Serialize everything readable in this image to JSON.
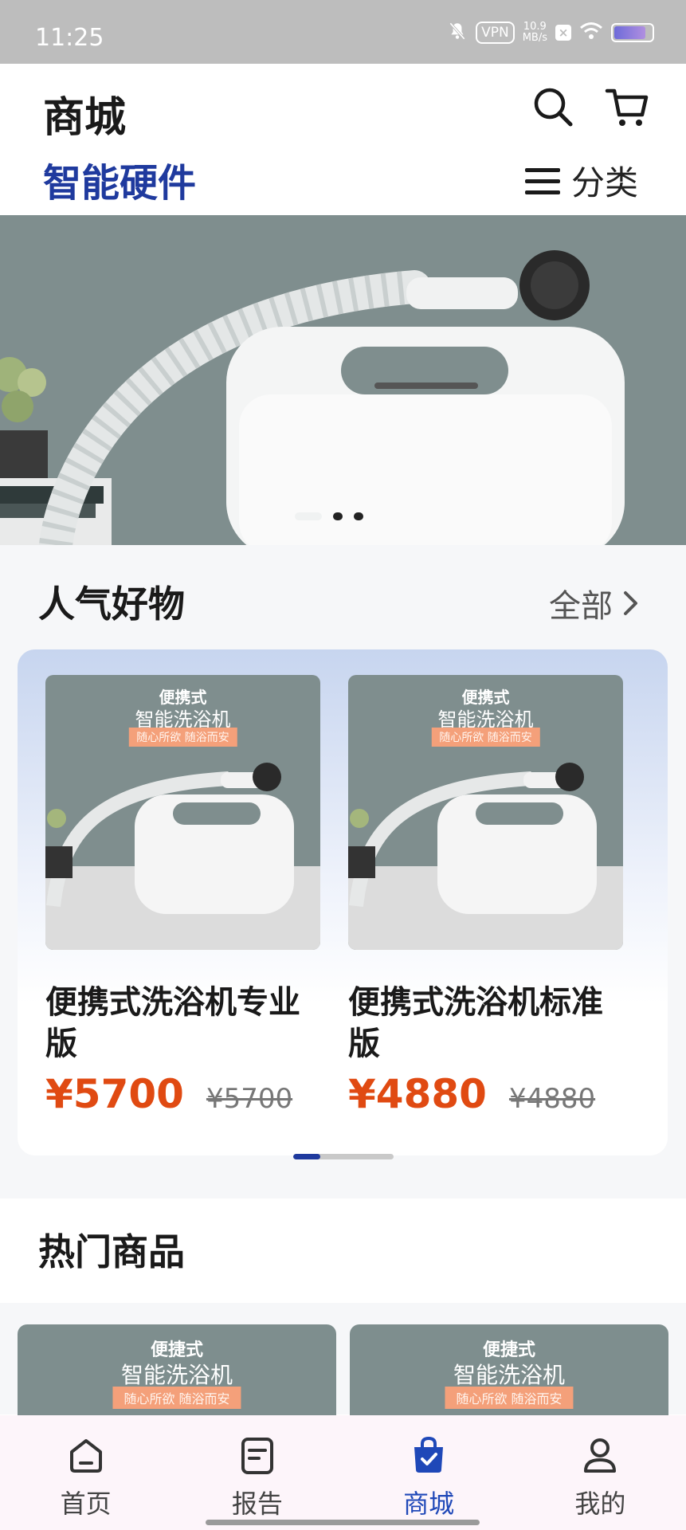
{
  "status_bar": {
    "time": "11:25",
    "vpn": "VPN",
    "net_speed_value": "10.9",
    "net_speed_unit": "MB/s",
    "battery_level": 0.85
  },
  "header": {
    "title": "商城",
    "subtitle": "智能硬件",
    "category_label": "分类",
    "icons": [
      "search-icon",
      "cart-icon",
      "menu-icon"
    ]
  },
  "banner": {
    "slide_count": 3,
    "active_slide": 1
  },
  "popular": {
    "title": "人气好物",
    "see_all": "全部",
    "products": [
      {
        "name": "便携式洗浴机专业版",
        "price": "¥5700",
        "original_price": "¥5700",
        "image_text": {
          "line1": "便携式",
          "line2": "智能洗浴机",
          "tag": "随心所欲 随浴而安"
        }
      },
      {
        "name": "便携式洗浴机标准版",
        "price": "¥4880",
        "original_price": "¥4880",
        "image_text": {
          "line1": "便携式",
          "line2": "智能洗浴机",
          "tag": "随心所欲 随浴而安"
        }
      }
    ],
    "scroll_position": 0.27
  },
  "hot": {
    "title": "热门商品",
    "cards": [
      {
        "line1": "便捷式",
        "line2": "智能洗浴机",
        "tag": "随心所欲 随浴而安"
      },
      {
        "line1": "便捷式",
        "line2": "智能洗浴机",
        "tag": "随心所欲 随浴而安"
      }
    ]
  },
  "tab_bar": {
    "tabs": [
      {
        "label": "首页",
        "icon": "home-icon"
      },
      {
        "label": "报告",
        "icon": "report-icon"
      },
      {
        "label": "商城",
        "icon": "shopping-bag-icon"
      },
      {
        "label": "我的",
        "icon": "profile-icon"
      }
    ],
    "active_index": 2
  },
  "colors": {
    "accent": "#1f3a9e",
    "price": "#e04a12",
    "tab_active": "#1f48b8"
  }
}
